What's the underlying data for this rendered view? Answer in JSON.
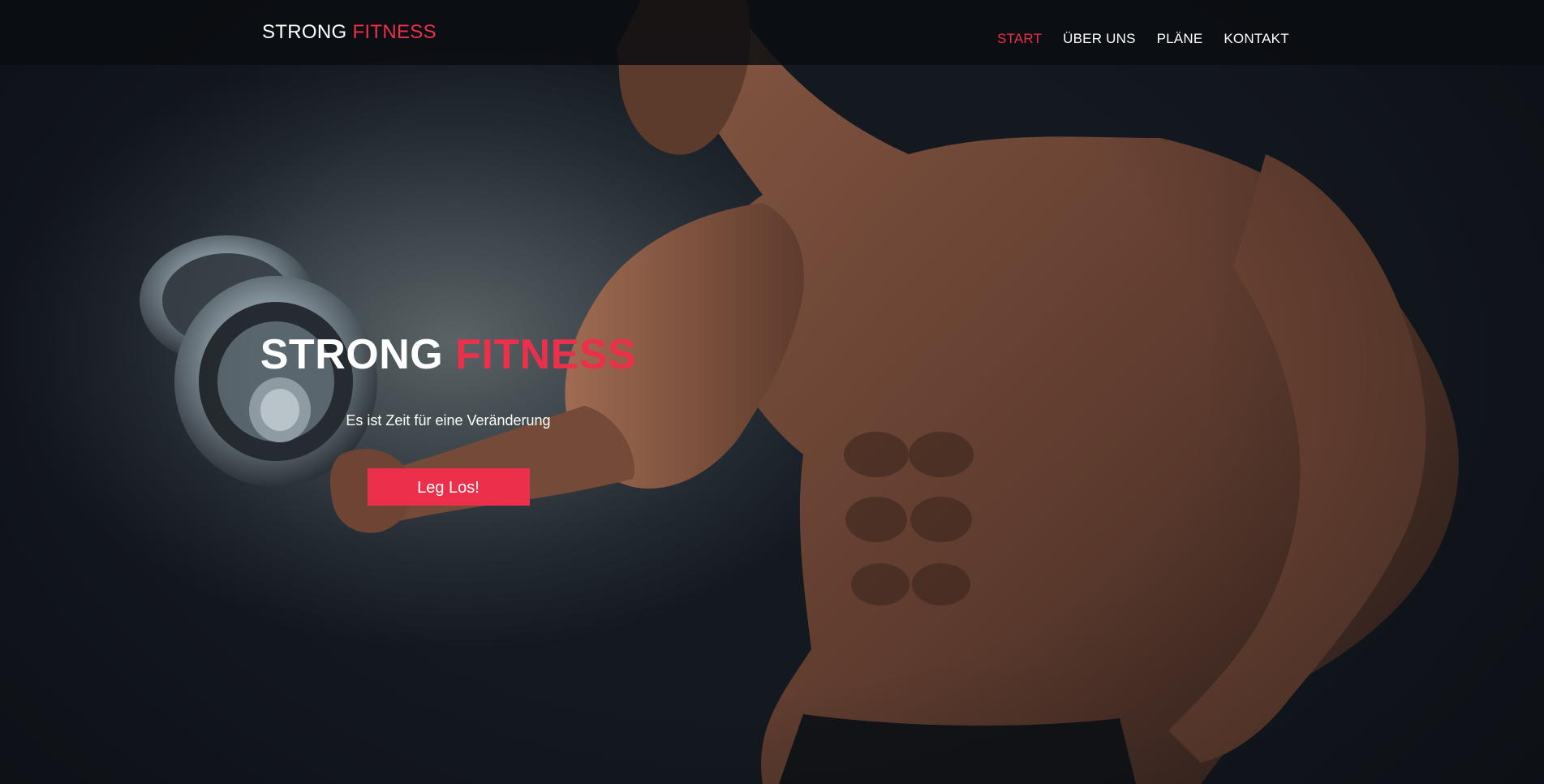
{
  "brand": {
    "part1": "STRONG",
    "part2": "FITNESS"
  },
  "nav": {
    "items": [
      {
        "label": "START",
        "active": true
      },
      {
        "label": "ÜBER UNS",
        "active": false
      },
      {
        "label": "PLÄNE",
        "active": false
      },
      {
        "label": "KONTAKT",
        "active": false
      }
    ]
  },
  "hero": {
    "title_part1": "STRONG",
    "title_part2": "FITNESS",
    "subtitle": "Es ist Zeit für eine Veränderung",
    "cta_label": "Leg Los!"
  },
  "colors": {
    "accent": "#ec2f4b",
    "nav_background": "#0a0c10",
    "text": "#ffffff"
  }
}
